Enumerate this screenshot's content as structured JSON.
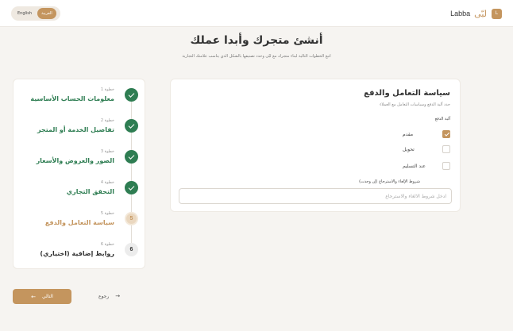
{
  "header": {
    "brand_latin": "Labba",
    "brand_arabic": "لبّى",
    "brand_badge": "L",
    "languages": [
      "English",
      "العربية"
    ],
    "active_language": "العربية"
  },
  "page": {
    "title": "أنشئ متجرك وأبدا عملك",
    "subtitle": "اتبع الخطوات التالية لبناء متجرك مع لبّى وحدد تصنيفها بالشكل الذي يناسب علامتك التجارية"
  },
  "steps": [
    {
      "num": "خطوة 1",
      "title": "معلومات الحساب الأساسية",
      "status": "done",
      "marker": ""
    },
    {
      "num": "خطوة 2",
      "title": "تفاصيل الخدمة أو المتجر",
      "status": "done",
      "marker": ""
    },
    {
      "num": "خطوة 3",
      "title": "الصور والعروض والأسعار",
      "status": "done",
      "marker": ""
    },
    {
      "num": "خطوة 4",
      "title": "التحقق التجاري",
      "status": "done",
      "marker": ""
    },
    {
      "num": "خطوة 5",
      "title": "سياسة التعامل والدفع",
      "status": "active",
      "marker": "5"
    },
    {
      "num": "خطوة 6",
      "title": "روابط إضافية (اختياري)",
      "status": "pending",
      "marker": "6"
    }
  ],
  "form": {
    "title": "سياسة التعامل والدفع",
    "description": "حدد آلية الدفع وسياسات التعامل مع العملاء",
    "payment_label": "آلية الدفع",
    "payment_options": [
      {
        "label": "مقدم",
        "checked": true
      },
      {
        "label": "تحويل",
        "checked": false
      },
      {
        "label": "عند التسليم",
        "checked": false
      }
    ],
    "terms_label": "شروط الإلغاء والاسترجاع (إن وجدت)",
    "terms_placeholder": "ادخل شروط الالغاء والاسترجاع",
    "terms_value": ""
  },
  "footer": {
    "next_label": "التالي",
    "back_label": "رجوع"
  },
  "colors": {
    "accent": "#c4955e",
    "success": "#2e7d52",
    "background": "#f6f4f1"
  }
}
